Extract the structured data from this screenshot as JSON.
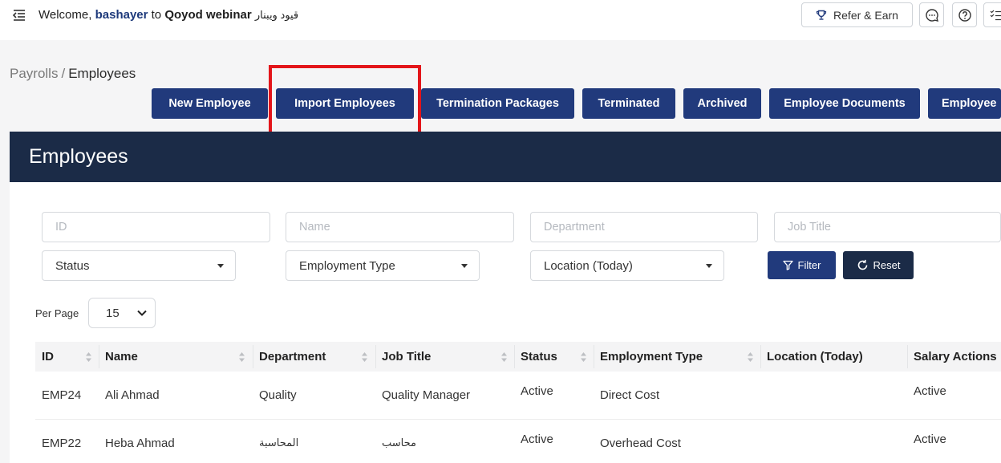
{
  "header": {
    "welcome_prefix": "Welcome,",
    "username": "bashayer",
    "welcome_mid": "to",
    "company": "Qoyod webinar",
    "company_ar": "قيود ويبنار",
    "refer_label": "Refer & Earn",
    "icons": [
      "menu-collapse-icon",
      "trophy-icon",
      "chat-icon",
      "help-icon",
      "checklist-icon"
    ]
  },
  "breadcrumb": {
    "parent": "Payrolls",
    "separator": "/",
    "current": "Employees"
  },
  "actions": {
    "new_employee": "New Employee",
    "import_employees": "Import Employees",
    "termination_packages": "Termination Packages",
    "terminated": "Terminated",
    "archived": "Archived",
    "employee_documents": "Employee Documents",
    "employee_more": "Employee"
  },
  "panel": {
    "title": "Employees"
  },
  "filters": {
    "id_placeholder": "ID",
    "name_placeholder": "Name",
    "department_placeholder": "Department",
    "job_title_placeholder": "Job Title",
    "status": "Status",
    "employment_type": "Employment Type",
    "location": "Location (Today)",
    "filter_label": "Filter",
    "reset_label": "Reset"
  },
  "pagination": {
    "per_page_label": "Per Page",
    "per_page_value": "15"
  },
  "table": {
    "columns": [
      "ID",
      "Name",
      "Department",
      "Job Title",
      "Status",
      "Employment Type",
      "Location (Today)",
      "Salary Actions"
    ],
    "rows": [
      {
        "id": "EMP24",
        "name": "Ali Ahmad",
        "department": "Quality",
        "job_title": "Quality Manager",
        "status": "Active",
        "employment_type": "Direct Cost",
        "location": "",
        "salary_status": "Active"
      },
      {
        "id": "EMP22",
        "name": "Heba Ahmad",
        "department": "المحاسبة",
        "job_title": "محاسب",
        "status": "Active",
        "employment_type": "Overhead Cost",
        "location": "",
        "salary_status": "Active"
      }
    ]
  },
  "colors": {
    "primary": "#213a7c",
    "header_dark": "#1b2b47",
    "highlight": "#e3151a",
    "username": "#1e3a7b"
  }
}
